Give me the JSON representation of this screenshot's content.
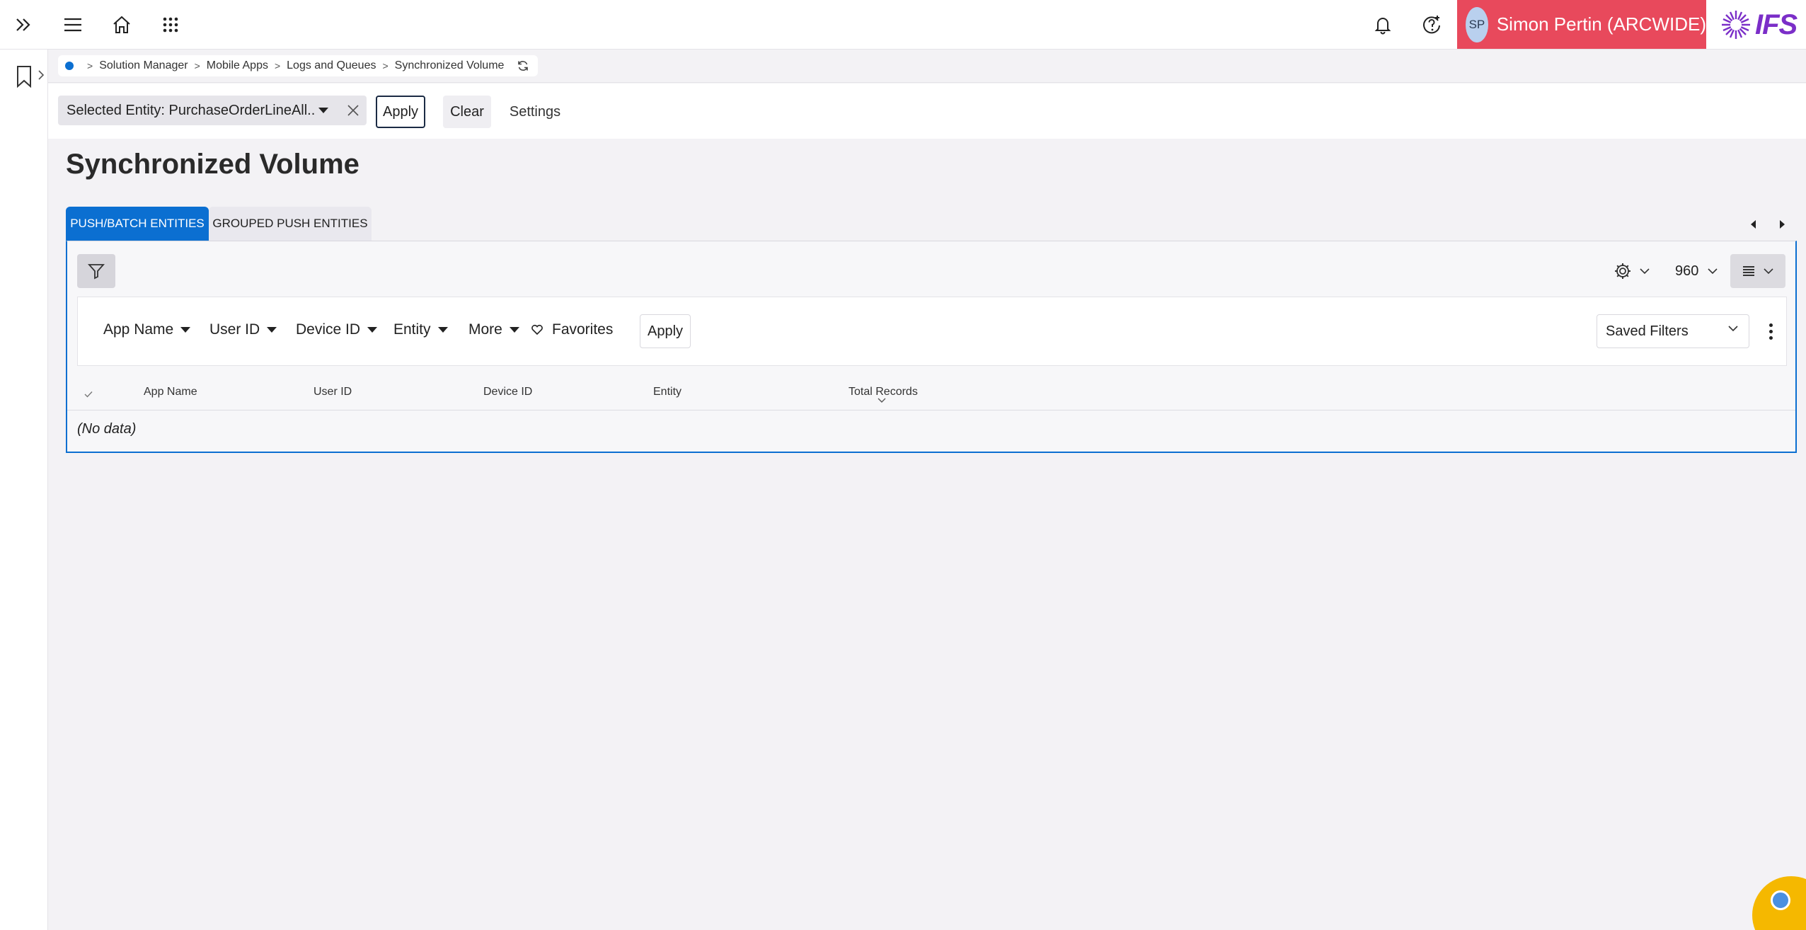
{
  "topbar": {
    "icons": [
      "expand-icon",
      "menu-icon",
      "home-icon",
      "apps-grid-icon",
      "bell-icon",
      "help-icon"
    ],
    "user": {
      "initials": "SP",
      "name": "Simon Pertin (ARCWIDE)"
    },
    "logo_text": "IFS",
    "accent_color": "#e8495c"
  },
  "breadcrumb": {
    "items": [
      "Solution Manager",
      "Mobile Apps",
      "Logs and Queues",
      "Synchronized Volume"
    ],
    "separator": ">"
  },
  "filter_toolbar": {
    "entity_chip": "Selected Entity: PurchaseOrderLineAll...",
    "apply_label": "Apply",
    "clear_label": "Clear",
    "settings_label": "Settings"
  },
  "page": {
    "title": "Synchronized Volume"
  },
  "tabs": [
    {
      "label": "PUSH/BATCH ENTITIES",
      "active": true
    },
    {
      "label": "GROUPED PUSH ENTITIES",
      "active": false
    }
  ],
  "panel": {
    "page_size": "960",
    "search_fields": [
      "App Name",
      "User ID",
      "Device ID",
      "Entity",
      "More"
    ],
    "favorites_label": "Favorites",
    "search_apply_label": "Apply",
    "saved_filters_label": "Saved Filters",
    "columns": [
      "App Name",
      "User ID",
      "Device ID",
      "Entity",
      "Total Records"
    ],
    "empty_text": "(No data)"
  },
  "colors": {
    "primary": "#0b6fd1",
    "background": "#f3f2f5",
    "brand": "#7b2ec8"
  }
}
